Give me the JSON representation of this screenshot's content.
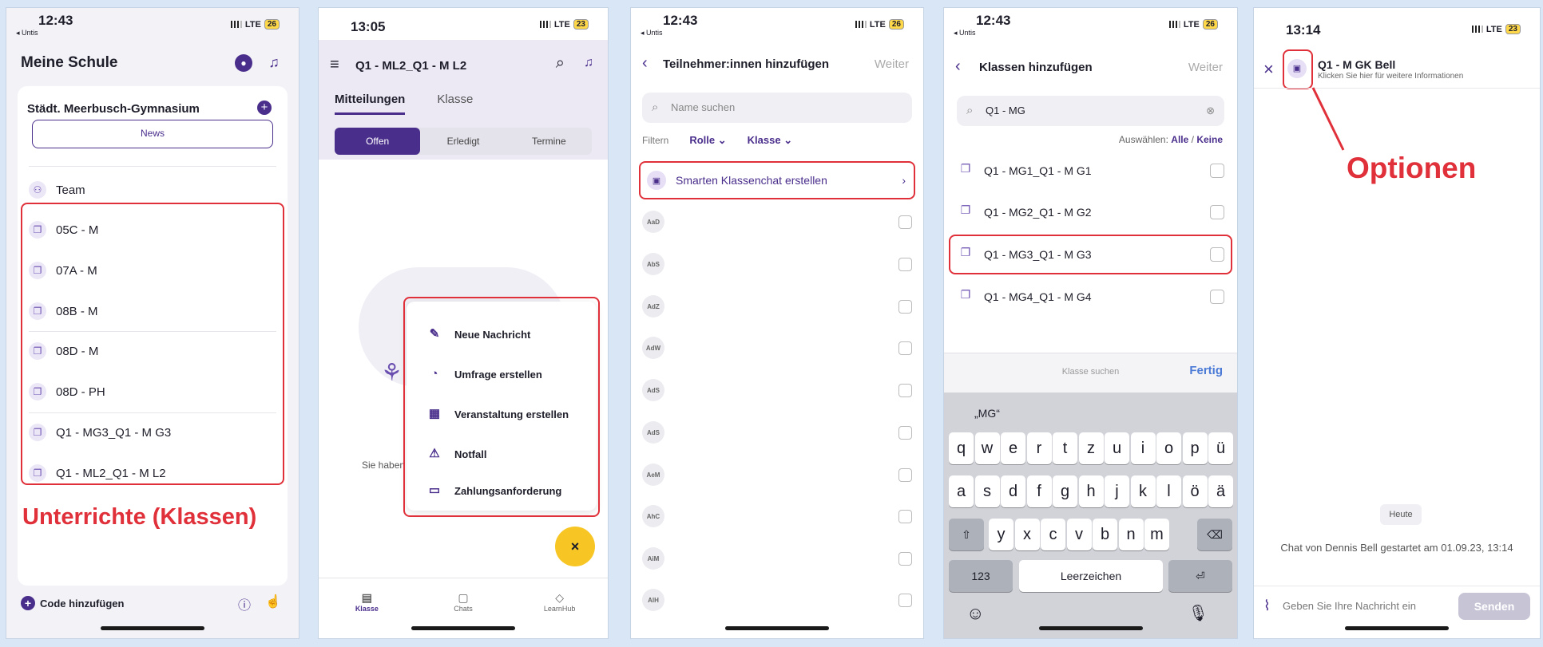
{
  "colors": {
    "accent": "#4a2e8c",
    "highlight": "#e0303a",
    "fab": "#f7c624",
    "background": "#d9e6f5"
  },
  "p1": {
    "status": {
      "time": "12:43",
      "back_app": "◂ Untis",
      "network": "LTE",
      "battery": "26"
    },
    "title": "Meine Schule",
    "school": "Städt. Meerbusch-Gymnasium",
    "news": "News",
    "team": "Team",
    "classes": [
      "05C - M",
      "07A - M",
      "08B - M",
      "08D - M",
      "08D - PH",
      "Q1 - MG3_Q1 - M G3",
      "Q1 - ML2_Q1 - M L2"
    ],
    "caption": "Unterrichte (Klassen)",
    "add_code": "Code hinzufügen"
  },
  "p2": {
    "status": {
      "time": "13:05",
      "network": "LTE",
      "battery": "23"
    },
    "title": "Q1 - ML2_Q1 - M L2",
    "tabs": [
      "Mitteilungen",
      "Klasse"
    ],
    "segments": [
      "Offen",
      "Erledigt",
      "Termine"
    ],
    "empty_text": "Sie haben",
    "menu": [
      "Neue Nachricht",
      "Umfrage erstellen",
      "Veranstaltung erstellen",
      "Notfall",
      "Zahlungsanforderung"
    ],
    "fab": "×",
    "nav": [
      "Klasse",
      "Chats",
      "LearnHub"
    ]
  },
  "p3": {
    "status": {
      "time": "12:43",
      "back_app": "◂ Untis",
      "network": "LTE",
      "battery": "26"
    },
    "title": "Teilnehmer:innen hinzufügen",
    "next": "Weiter",
    "search_placeholder": "Name suchen",
    "filter_label": "Filtern",
    "filter_role": "Rolle",
    "filter_class": "Klasse",
    "smart_chat": "Smarten Klassenchat erstellen",
    "participants": [
      "AaD",
      "AbS",
      "AdZ",
      "AdW",
      "AdS",
      "AdS",
      "AeM",
      "AhC",
      "AiM",
      "AlH"
    ]
  },
  "p4": {
    "status": {
      "time": "12:43",
      "back_app": "◂ Untis",
      "network": "LTE",
      "battery": "26"
    },
    "title": "Klassen hinzufügen",
    "next": "Weiter",
    "search_value": "Q1 - MG",
    "select_label": "Auswählen:",
    "select_all": "Alle",
    "select_none": "Keine",
    "classes": [
      "Q1 - MG1_Q1 - M G1",
      "Q1 - MG2_Q1 - M G2",
      "Q1 - MG3_Q1 - M G3",
      "Q1 - MG4_Q1 - M G4"
    ],
    "kb_search": "Klasse suchen",
    "done": "Fertig",
    "suggestion": "„MG“",
    "keys_row1": [
      "q",
      "w",
      "e",
      "r",
      "t",
      "z",
      "u",
      "i",
      "o",
      "p",
      "ü"
    ],
    "keys_row2": [
      "a",
      "s",
      "d",
      "f",
      "g",
      "h",
      "j",
      "k",
      "l",
      "ö",
      "ä"
    ],
    "keys_row3": [
      "y",
      "x",
      "c",
      "v",
      "b",
      "n",
      "m"
    ],
    "key_123": "123",
    "space": "Leerzeichen"
  },
  "p5": {
    "status": {
      "time": "13:14",
      "network": "LTE",
      "battery": "23"
    },
    "chat_title": "Q1 - M GK Bell",
    "chat_subtitle": "Klicken Sie hier für weitere Informationen",
    "options_label": "Optionen",
    "day": "Heute",
    "started": "Chat von Dennis Bell gestartet am 01.09.23, 13:14",
    "input_placeholder": "Geben Sie Ihre Nachricht ein",
    "send": "Senden"
  }
}
